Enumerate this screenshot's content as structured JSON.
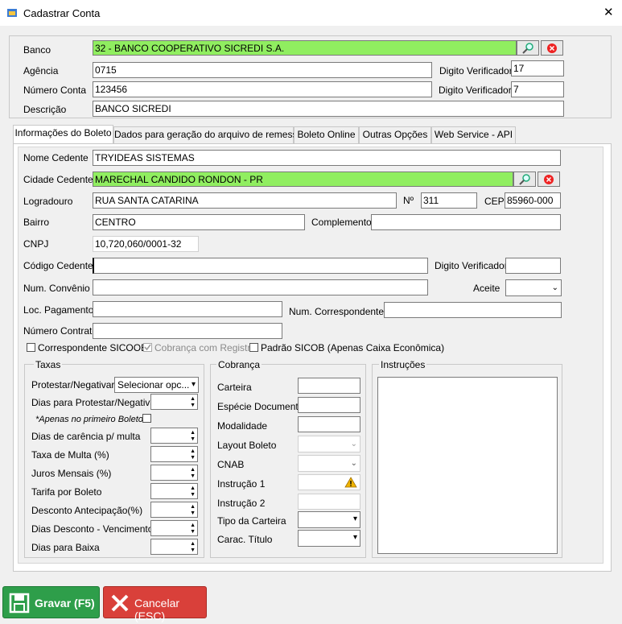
{
  "window": {
    "title": "Cadastrar Conta",
    "close_glyph": "✕"
  },
  "header": {
    "banco_label": "Banco",
    "banco_value": "32 - BANCO COOPERATIVO SICREDI S.A.",
    "agencia_label": "Agência",
    "agencia_value": "0715",
    "dv_agencia_label": "Digito Verificador",
    "dv_agencia_value": "17",
    "numero_conta_label": "Número Conta",
    "numero_conta_value": "123456",
    "dv_conta_label": "Digito Verificador",
    "dv_conta_value": "7",
    "descricao_label": "Descrição",
    "descricao_value": "BANCO SICREDI"
  },
  "tabs": [
    "Informações do Boleto",
    "Dados para geração do arquivo de remessa",
    "Boleto Online",
    "Outras Opções",
    "Web Service - API"
  ],
  "boleto": {
    "nome_cedente_label": "Nome Cedente",
    "nome_cedente_value": "TRYIDEAS SISTEMAS",
    "cidade_cedente_label": "Cidade Cedente",
    "cidade_cedente_value": "MARECHAL CANDIDO RONDON - PR",
    "logradouro_label": "Logradouro",
    "logradouro_value": "RUA SANTA CATARINA",
    "numero_label": "Nº",
    "numero_value": "311",
    "cep_label": "CEP",
    "cep_value": "85960-000",
    "bairro_label": "Bairro",
    "bairro_value": "CENTRO",
    "complemento_label": "Complemento",
    "complemento_value": "",
    "cnpj_label": "CNPJ",
    "cnpj_value": "10,720,060/0001-32",
    "codigo_cedente_label": "Código Cedente",
    "codigo_cedente_value": "",
    "dv_label": "Digito Verificador",
    "num_convenio_label": "Num. Convênio",
    "aceite_label": "Aceite",
    "loc_pagamento_label": "Loc. Pagamento",
    "num_correspondente_label": "Num. Correspondente",
    "numero_contrato_label": "Número Contrato",
    "chk_correspondente": "Correspondente SICOOB",
    "chk_cobranca_registro": "Cobrança com Registro",
    "chk_padrao_sicob": "Padrão SICOB (Apenas Caixa Econômica)"
  },
  "taxas": {
    "title": "Taxas",
    "protestar_label": "Protestar/Negativar?",
    "protestar_value": "Selecionar opc...",
    "dias_protestar_label": "Dias para Protestar/Negativar",
    "apenas_primeiro": "*Apenas no primeiro Boleto",
    "dias_carencia_label": "Dias de carência p/ multa",
    "taxa_multa_label": "Taxa de Multa (%)",
    "juros_label": "Juros Mensais (%)",
    "tarifa_label": "Tarifa por Boleto",
    "desconto_label": "Desconto Antecipação(%)",
    "dias_desconto_label": "Dias Desconto - Vencimento",
    "dias_baixa_label": "Dias para Baixa"
  },
  "cobranca": {
    "title": "Cobrança",
    "carteira_label": "Carteira",
    "especie_label": "Espécie Documento",
    "modalidade_label": "Modalidade",
    "layout_label": "Layout Boleto",
    "cnab_label": "CNAB",
    "instrucao1_label": "Instrução 1",
    "instrucao2_label": "Instrução 2",
    "tipo_carteira_label": "Tipo da Carteira",
    "carac_titulo_label": "Carac. Título"
  },
  "instrucoes": {
    "title": "Instruções"
  },
  "footer": {
    "gravar_label": "Gravar (F5)",
    "cancelar_label": "Cancelar (ESC)"
  },
  "colors": {
    "highlight": "#90ee60",
    "gravar": "#2e9e4a",
    "cancelar": "#d9403a"
  }
}
